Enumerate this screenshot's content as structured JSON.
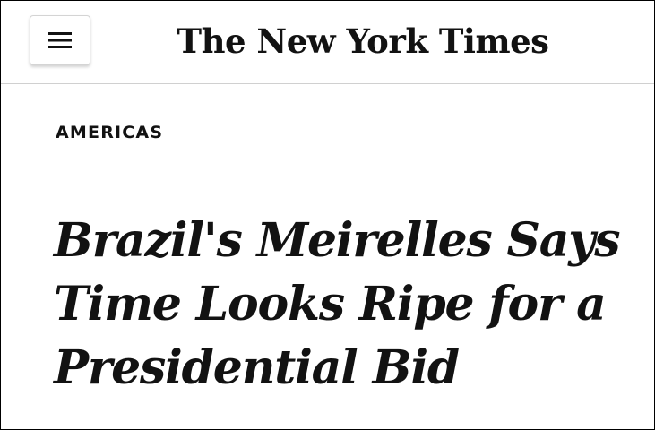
{
  "header": {
    "logo_text": "The New York Times",
    "menu_icon": "hamburger-menu-icon"
  },
  "article": {
    "section": "AMERICAS",
    "headline": "Brazil's Meirelles Says Time Looks Ripe for a Presidential Bid"
  }
}
